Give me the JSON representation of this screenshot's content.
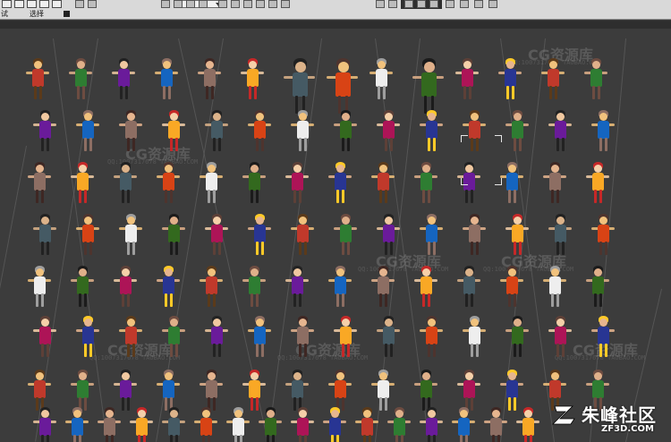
{
  "toolbar": {
    "mode_label": "试",
    "select_label": "选择"
  },
  "viewport": {
    "background": "#3c3c3c",
    "watermark_text": "CG资源库",
    "watermark_sub": "QQ:1007317678 TAOBAO.COM"
  },
  "logo": {
    "name_cn": "朱峰社区",
    "domain": "ZF3D.COM"
  },
  "colors": {
    "toolbar_bg": "#d9d9d9",
    "viewport_bg": "#3c3c3c",
    "grid_line": "#6a6a6a",
    "selection": "#e6e6e6"
  }
}
